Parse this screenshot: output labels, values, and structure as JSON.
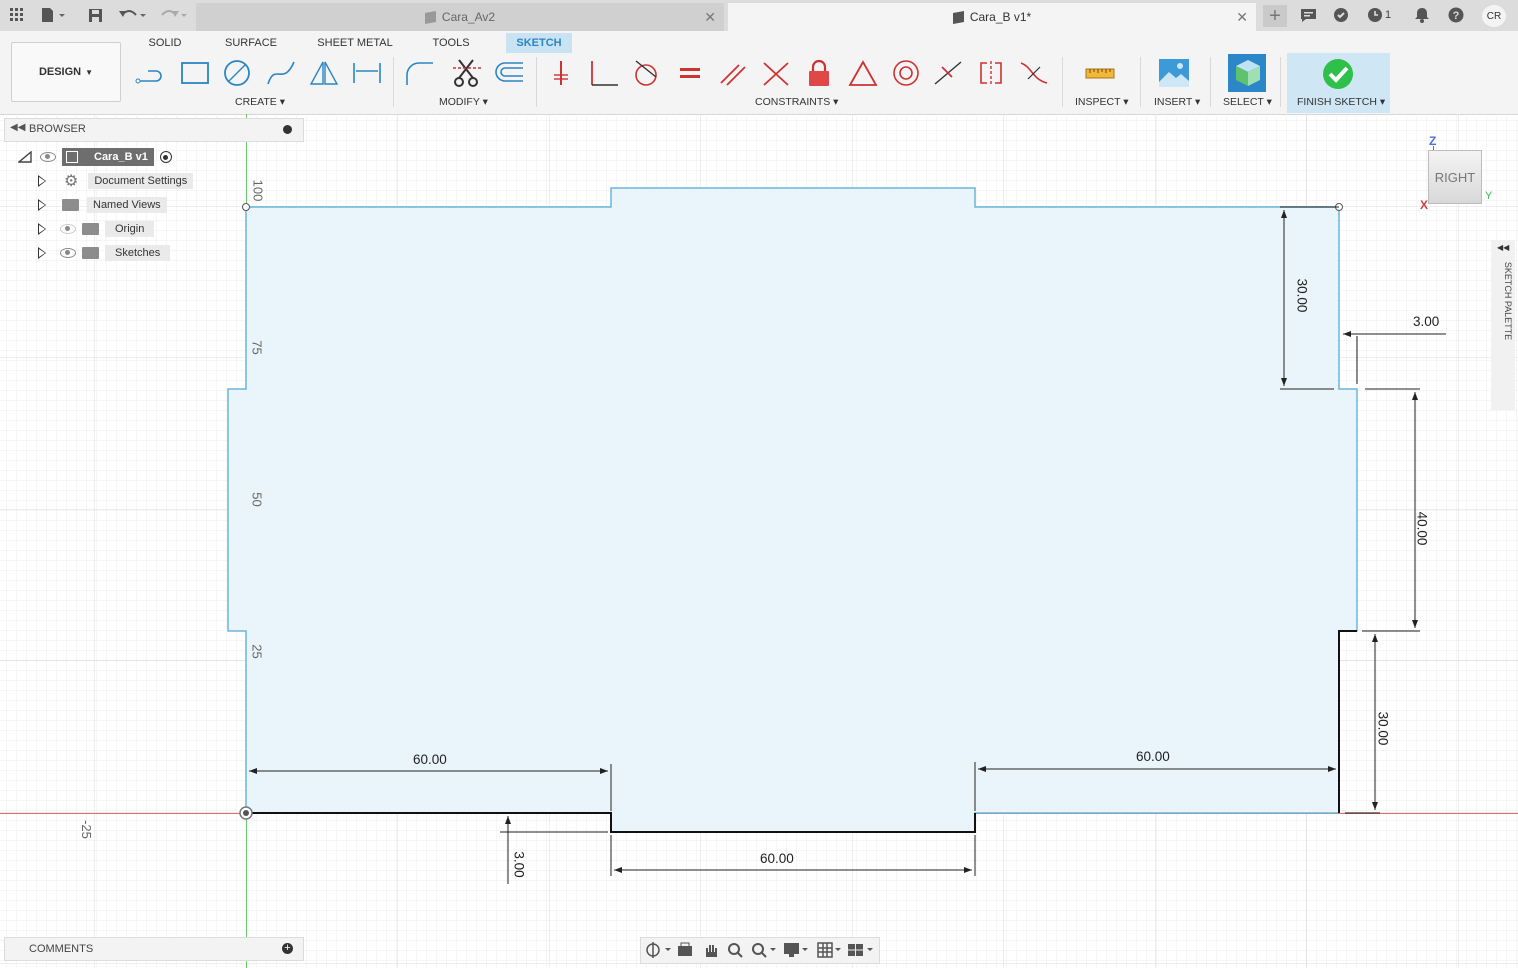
{
  "titlebar": {
    "tab1_label": "Cara_Av2",
    "tab2_label": "Cara_B v1*",
    "notifications_count": "1",
    "user_initials": "CR"
  },
  "toolbar": {
    "design_label": "DESIGN",
    "workspace_tabs": [
      "SOLID",
      "SURFACE",
      "SHEET METAL",
      "TOOLS",
      "SKETCH"
    ],
    "groups": {
      "create": "CREATE",
      "modify": "MODIFY",
      "constraints": "CONSTRAINTS",
      "inspect": "INSPECT",
      "insert": "INSERT",
      "select": "SELECT",
      "finish": "FINISH SKETCH"
    }
  },
  "browser": {
    "title": "BROWSER",
    "root": "Cara_B v1",
    "items": [
      "Document Settings",
      "Named Views",
      "Origin",
      "Sketches"
    ]
  },
  "comments": {
    "title": "COMMENTS"
  },
  "viewcube": {
    "face": "RIGHT",
    "axis_z": "Z",
    "axis_x": "X",
    "axis_y": "Y"
  },
  "sketch_palette": {
    "label": "SKETCH PALETTE"
  },
  "canvas": {
    "ruler_labels": [
      "100",
      "75",
      "50",
      "25",
      "-25"
    ],
    "dimensions": {
      "top_right_height": "30.00",
      "right_offset": "3.00",
      "right_mid_height": "40.00",
      "right_bottom_height": "30.00",
      "bottom_left_width": "60.00",
      "bottom_right_width": "60.00",
      "bottom_center_width": "60.00",
      "bottom_offset": "3.00"
    }
  },
  "colors": {
    "accent": "#2a86c4",
    "profile_fill": "#e9f4fb",
    "profile_edge": "#6bb6dc",
    "finish_green": "#2ec04a"
  }
}
